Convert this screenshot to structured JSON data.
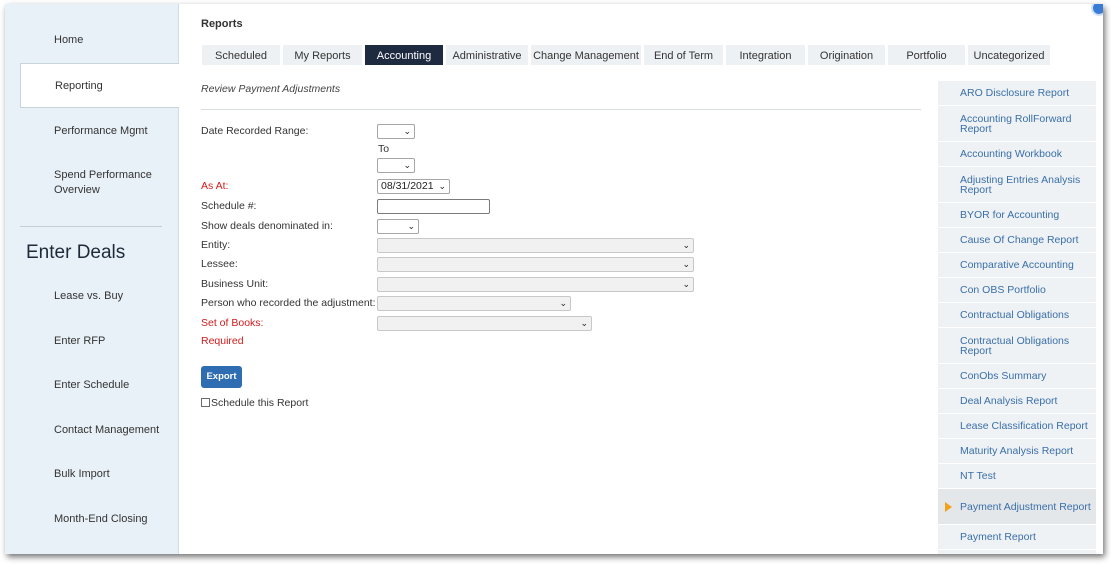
{
  "sidebar": {
    "items": [
      {
        "label": "Home"
      },
      {
        "label": "Reporting"
      },
      {
        "label": "Performance Mgmt"
      },
      {
        "label": "Spend Performance Overview"
      }
    ],
    "section_heading": "Enter Deals",
    "deal_items": [
      {
        "label": "Lease vs. Buy"
      },
      {
        "label": "Enter RFP"
      },
      {
        "label": "Enter Schedule"
      },
      {
        "label": "Contact Management"
      },
      {
        "label": "Bulk Import"
      },
      {
        "label": "Month-End Closing"
      }
    ]
  },
  "page": {
    "heading": "Reports",
    "subtitle": "Review Payment Adjustments"
  },
  "tabs": [
    {
      "label": "Scheduled"
    },
    {
      "label": "My Reports"
    },
    {
      "label": "Accounting"
    },
    {
      "label": "Administrative"
    },
    {
      "label": "Change Management"
    },
    {
      "label": "End of Term"
    },
    {
      "label": "Integration"
    },
    {
      "label": "Origination"
    },
    {
      "label": "Portfolio"
    },
    {
      "label": "Uncategorized"
    }
  ],
  "active_tab": "Accounting",
  "form": {
    "date_recorded_range_label": "Date Recorded Range:",
    "to_label": "To",
    "as_at_label": "As At:",
    "as_at_value": "08/31/2021",
    "schedule_label": "Schedule #:",
    "schedule_value": "",
    "denominated_label": "Show deals denominated in:",
    "entity_label": "Entity:",
    "lessee_label": "Lessee:",
    "business_unit_label": "Business Unit:",
    "person_label": "Person who recorded the adjustment:",
    "set_of_books_label": "Set of Books:",
    "required_text": "Required",
    "export_label": "Export",
    "schedule_report_label": "Schedule this Report",
    "schedule_report_checked": false
  },
  "reports": {
    "items": [
      {
        "label": "ARO Disclosure Report"
      },
      {
        "label": "Accounting RollForward Report"
      },
      {
        "label": "Accounting Workbook"
      },
      {
        "label": "Adjusting Entries Analysis Report"
      },
      {
        "label": "BYOR for Accounting"
      },
      {
        "label": "Cause Of Change Report"
      },
      {
        "label": "Comparative Accounting"
      },
      {
        "label": "Con OBS Portfolio"
      },
      {
        "label": "Contractual Obligations"
      },
      {
        "label": "Contractual Obligations Report"
      },
      {
        "label": "ConObs Summary"
      },
      {
        "label": "Deal Analysis Report"
      },
      {
        "label": "Lease Classification Report"
      },
      {
        "label": "Maturity Analysis Report"
      },
      {
        "label": "NT Test"
      },
      {
        "label": "Payment Adjustment Report"
      },
      {
        "label": "Payment Report"
      }
    ],
    "selected": "Payment Adjustment Report"
  },
  "icons": {
    "dropdown": "chevron-down-icon",
    "selected_marker": "arrow-right-icon",
    "corner": "circle-icon"
  },
  "colors": {
    "active_tab_bg": "#1d2a40",
    "required_text": "#d11a1a",
    "link_text": "#3a6fa8",
    "button_bg": "#2f6db3",
    "sidebar_bg": "#e8f1f7",
    "marker": "#f0a31a"
  }
}
